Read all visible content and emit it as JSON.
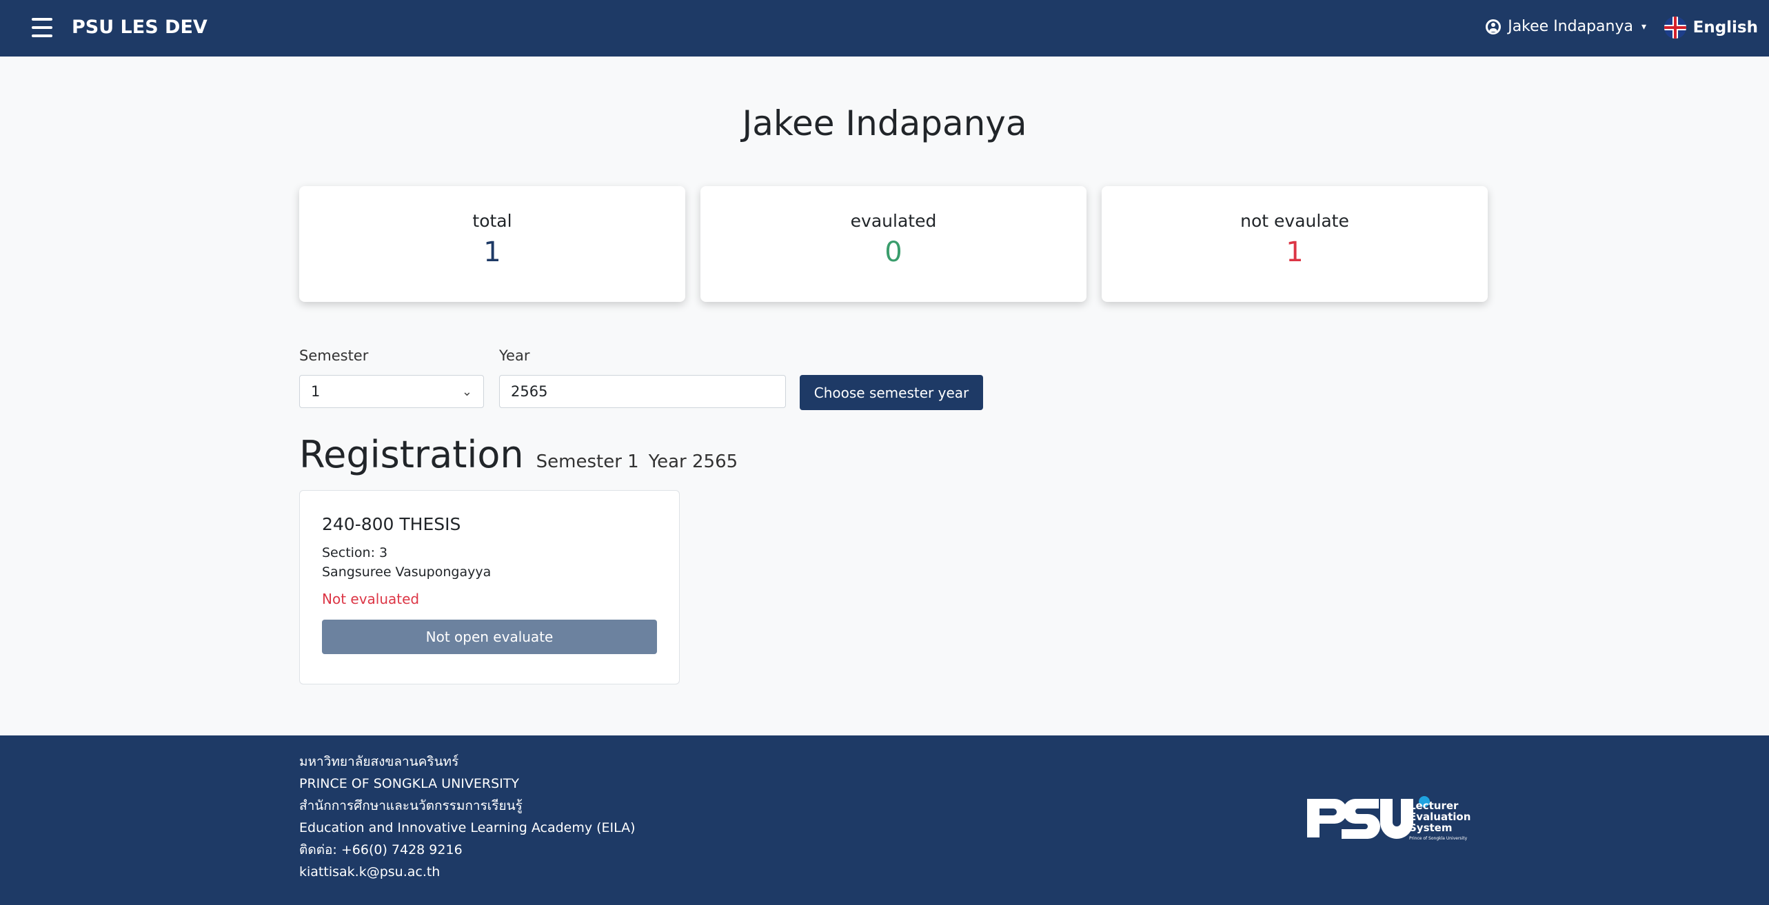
{
  "header": {
    "app_title": "PSU LES DEV",
    "user_name": "Jakee Indapanya",
    "language": "English"
  },
  "page": {
    "title": "Jakee Indapanya"
  },
  "stats": [
    {
      "label": "total",
      "value": "1"
    },
    {
      "label": "evaulated",
      "value": "0"
    },
    {
      "label": "not evaulate",
      "value": "1"
    }
  ],
  "filters": {
    "semester_label": "Semester",
    "semester_value": "1",
    "year_label": "Year",
    "year_value": "2565",
    "choose_button": "Choose semester year"
  },
  "registration": {
    "title": "Registration",
    "semester_text": "Semester 1",
    "year_text": "Year 2565"
  },
  "courses": [
    {
      "title": "240-800 THESIS",
      "section": "Section: 3",
      "lecturer": "Sangsuree Vasupongayya",
      "status": "Not evaluated",
      "button": "Not open evaluate"
    }
  ],
  "footer": {
    "lines": [
      "มหาวิทยาลัยสงขลานครินทร์",
      "PRINCE OF SONGKLA UNIVERSITY",
      "สำนักการศึกษาและนวัตกรรมการเรียนรู้",
      "Education and Innovative Learning Academy (EILA)",
      "ติดต่อ: +66(0) 7428 9216",
      "kiattisak.k@psu.ac.th"
    ],
    "logo_wordmark": "PSU",
    "logo_line1": "Lecturer",
    "logo_line2": "Evaluation",
    "logo_line3": "System",
    "logo_line4": "Prince of Songkla University"
  },
  "colors": {
    "primary": "#1e3a66",
    "evaluated": "#3a9d6c",
    "not_evaluated": "#dc3545",
    "disabled_button": "#6c829f"
  }
}
